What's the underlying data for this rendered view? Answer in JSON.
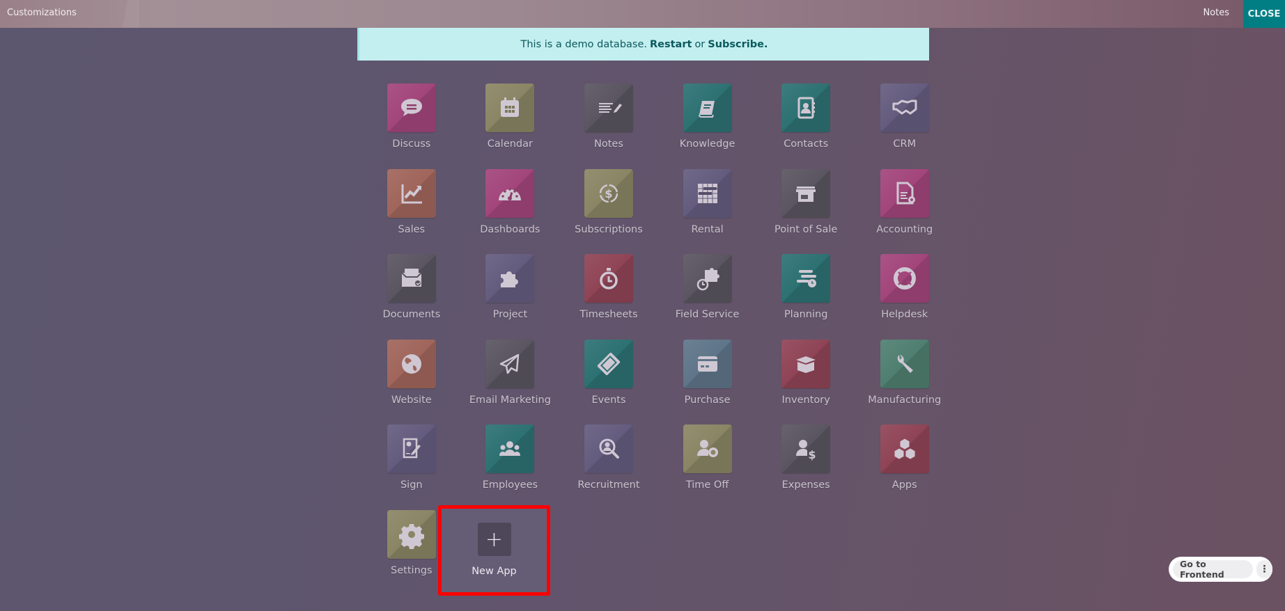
{
  "topbar": {
    "title": "Customizations",
    "notes_label": "Notes",
    "close_label": "CLOSE"
  },
  "banner": {
    "text": "This is a demo database.",
    "restart_label": "Restart",
    "or_text": "or",
    "subscribe_label": "Subscribe."
  },
  "apps": [
    {
      "label": "Discuss",
      "icon": "chat-bubble-icon",
      "color": "#a2457b"
    },
    {
      "label": "Calendar",
      "icon": "calendar-icon",
      "color": "#8a8564"
    },
    {
      "label": "Notes",
      "icon": "notes-pencil-icon",
      "color": "#5a5560"
    },
    {
      "label": "Knowledge",
      "icon": "book-icon",
      "color": "#2d7173"
    },
    {
      "label": "Contacts",
      "icon": "address-book-icon",
      "color": "#2d7173"
    },
    {
      "label": "CRM",
      "icon": "handshake-icon",
      "color": "#645c7e"
    },
    {
      "label": "Sales",
      "icon": "chart-trend-icon",
      "color": "#a0655b"
    },
    {
      "label": "Dashboards",
      "icon": "gauge-icon",
      "color": "#a2457b"
    },
    {
      "label": "Subscriptions",
      "icon": "recurring-dollar-icon",
      "color": "#8a8564"
    },
    {
      "label": "Rental",
      "icon": "gantt-grid-icon",
      "color": "#645c7e"
    },
    {
      "label": "Point of Sale",
      "icon": "shop-icon",
      "color": "#5a5560"
    },
    {
      "label": "Accounting",
      "icon": "document-gear-icon",
      "color": "#a2457b"
    },
    {
      "label": "Documents",
      "icon": "inbox-check-icon",
      "color": "#5a5560"
    },
    {
      "label": "Project",
      "icon": "puzzle-icon",
      "color": "#645c7e"
    },
    {
      "label": "Timesheets",
      "icon": "stopwatch-icon",
      "color": "#8f4456"
    },
    {
      "label": "Field Service",
      "icon": "puzzle-stopwatch-icon",
      "color": "#5a5560"
    },
    {
      "label": "Planning",
      "icon": "planning-clock-icon",
      "color": "#2d7173"
    },
    {
      "label": "Helpdesk",
      "icon": "lifebuoy-icon",
      "color": "#a2457b"
    },
    {
      "label": "Website",
      "icon": "globe-icon",
      "color": "#a0655b"
    },
    {
      "label": "Email Marketing",
      "icon": "paper-plane-icon",
      "color": "#5a5560"
    },
    {
      "label": "Events",
      "icon": "ticket-icon",
      "color": "#2d7173"
    },
    {
      "label": "Purchase",
      "icon": "credit-card-icon",
      "color": "#5f7589"
    },
    {
      "label": "Inventory",
      "icon": "open-box-icon",
      "color": "#8f4456"
    },
    {
      "label": "Manufacturing",
      "icon": "wrench-icon",
      "color": "#4f7f70"
    },
    {
      "label": "Sign",
      "icon": "signature-icon",
      "color": "#645c7e"
    },
    {
      "label": "Employees",
      "icon": "people-icon",
      "color": "#2d7173"
    },
    {
      "label": "Recruitment",
      "icon": "person-search-icon",
      "color": "#645c7e"
    },
    {
      "label": "Time Off",
      "icon": "person-gear-icon",
      "color": "#8a8564"
    },
    {
      "label": "Expenses",
      "icon": "person-dollar-icon",
      "color": "#5a5560"
    },
    {
      "label": "Apps",
      "icon": "cubes-icon",
      "color": "#8f4456"
    },
    {
      "label": "Settings",
      "icon": "gear-icon",
      "color": "#8a8564"
    }
  ],
  "new_app": {
    "label": "New App",
    "icon": "plus-icon",
    "highlight_color": "#ff0000"
  },
  "frontend": {
    "button_label": "Go to Frontend",
    "more_icon": "vertical-ellipsis-icon"
  }
}
